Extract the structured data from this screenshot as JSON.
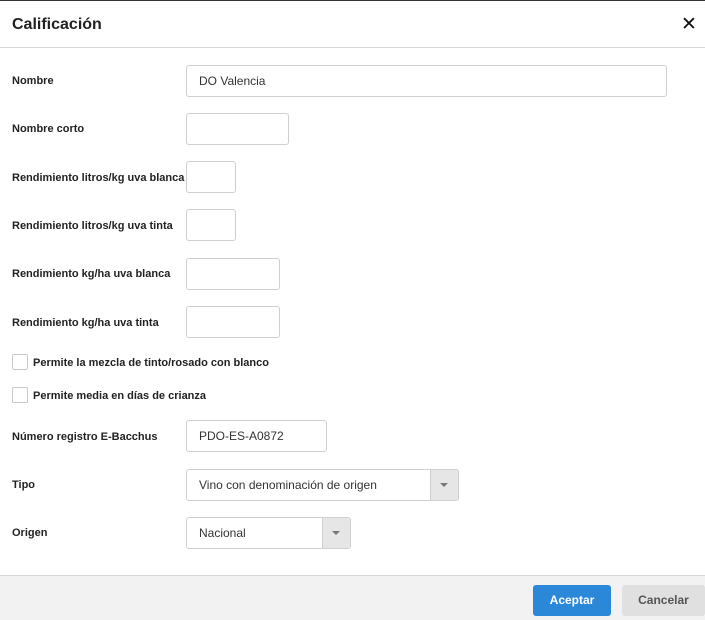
{
  "dialog": {
    "title": "Calificación",
    "close_icon": "close-icon"
  },
  "form": {
    "nombre": {
      "label": "Nombre",
      "value": "DO Valencia"
    },
    "nombre_corto": {
      "label": "Nombre corto",
      "value": ""
    },
    "rend_litros_blanca": {
      "label": "Rendimiento litros/kg uva blanca",
      "value": ""
    },
    "rend_litros_tinta": {
      "label": "Rendimiento litros/kg uva tinta",
      "value": ""
    },
    "rend_kgha_blanca": {
      "label": "Rendimiento kg/ha uva blanca",
      "value": ""
    },
    "rend_kgha_tinta": {
      "label": "Rendimiento kg/ha uva tinta",
      "value": ""
    },
    "mezcla": {
      "label": "Permite la mezcla de tinto/rosado con blanco",
      "checked": false
    },
    "media_crianza": {
      "label": "Permite media en días de crianza",
      "checked": false
    },
    "registro": {
      "label": "Número registro E-Bacchus",
      "value": "PDO-ES-A0872"
    },
    "tipo": {
      "label": "Tipo",
      "value": "Vino con denominación de origen"
    },
    "origen": {
      "label": "Origen",
      "value": "Nacional"
    }
  },
  "footer": {
    "accept_label": "Aceptar",
    "cancel_label": "Cancelar"
  },
  "colors": {
    "primary": "#2b87d8",
    "secondary": "#e0e0e0",
    "footer_bg": "#f2f2f2"
  }
}
